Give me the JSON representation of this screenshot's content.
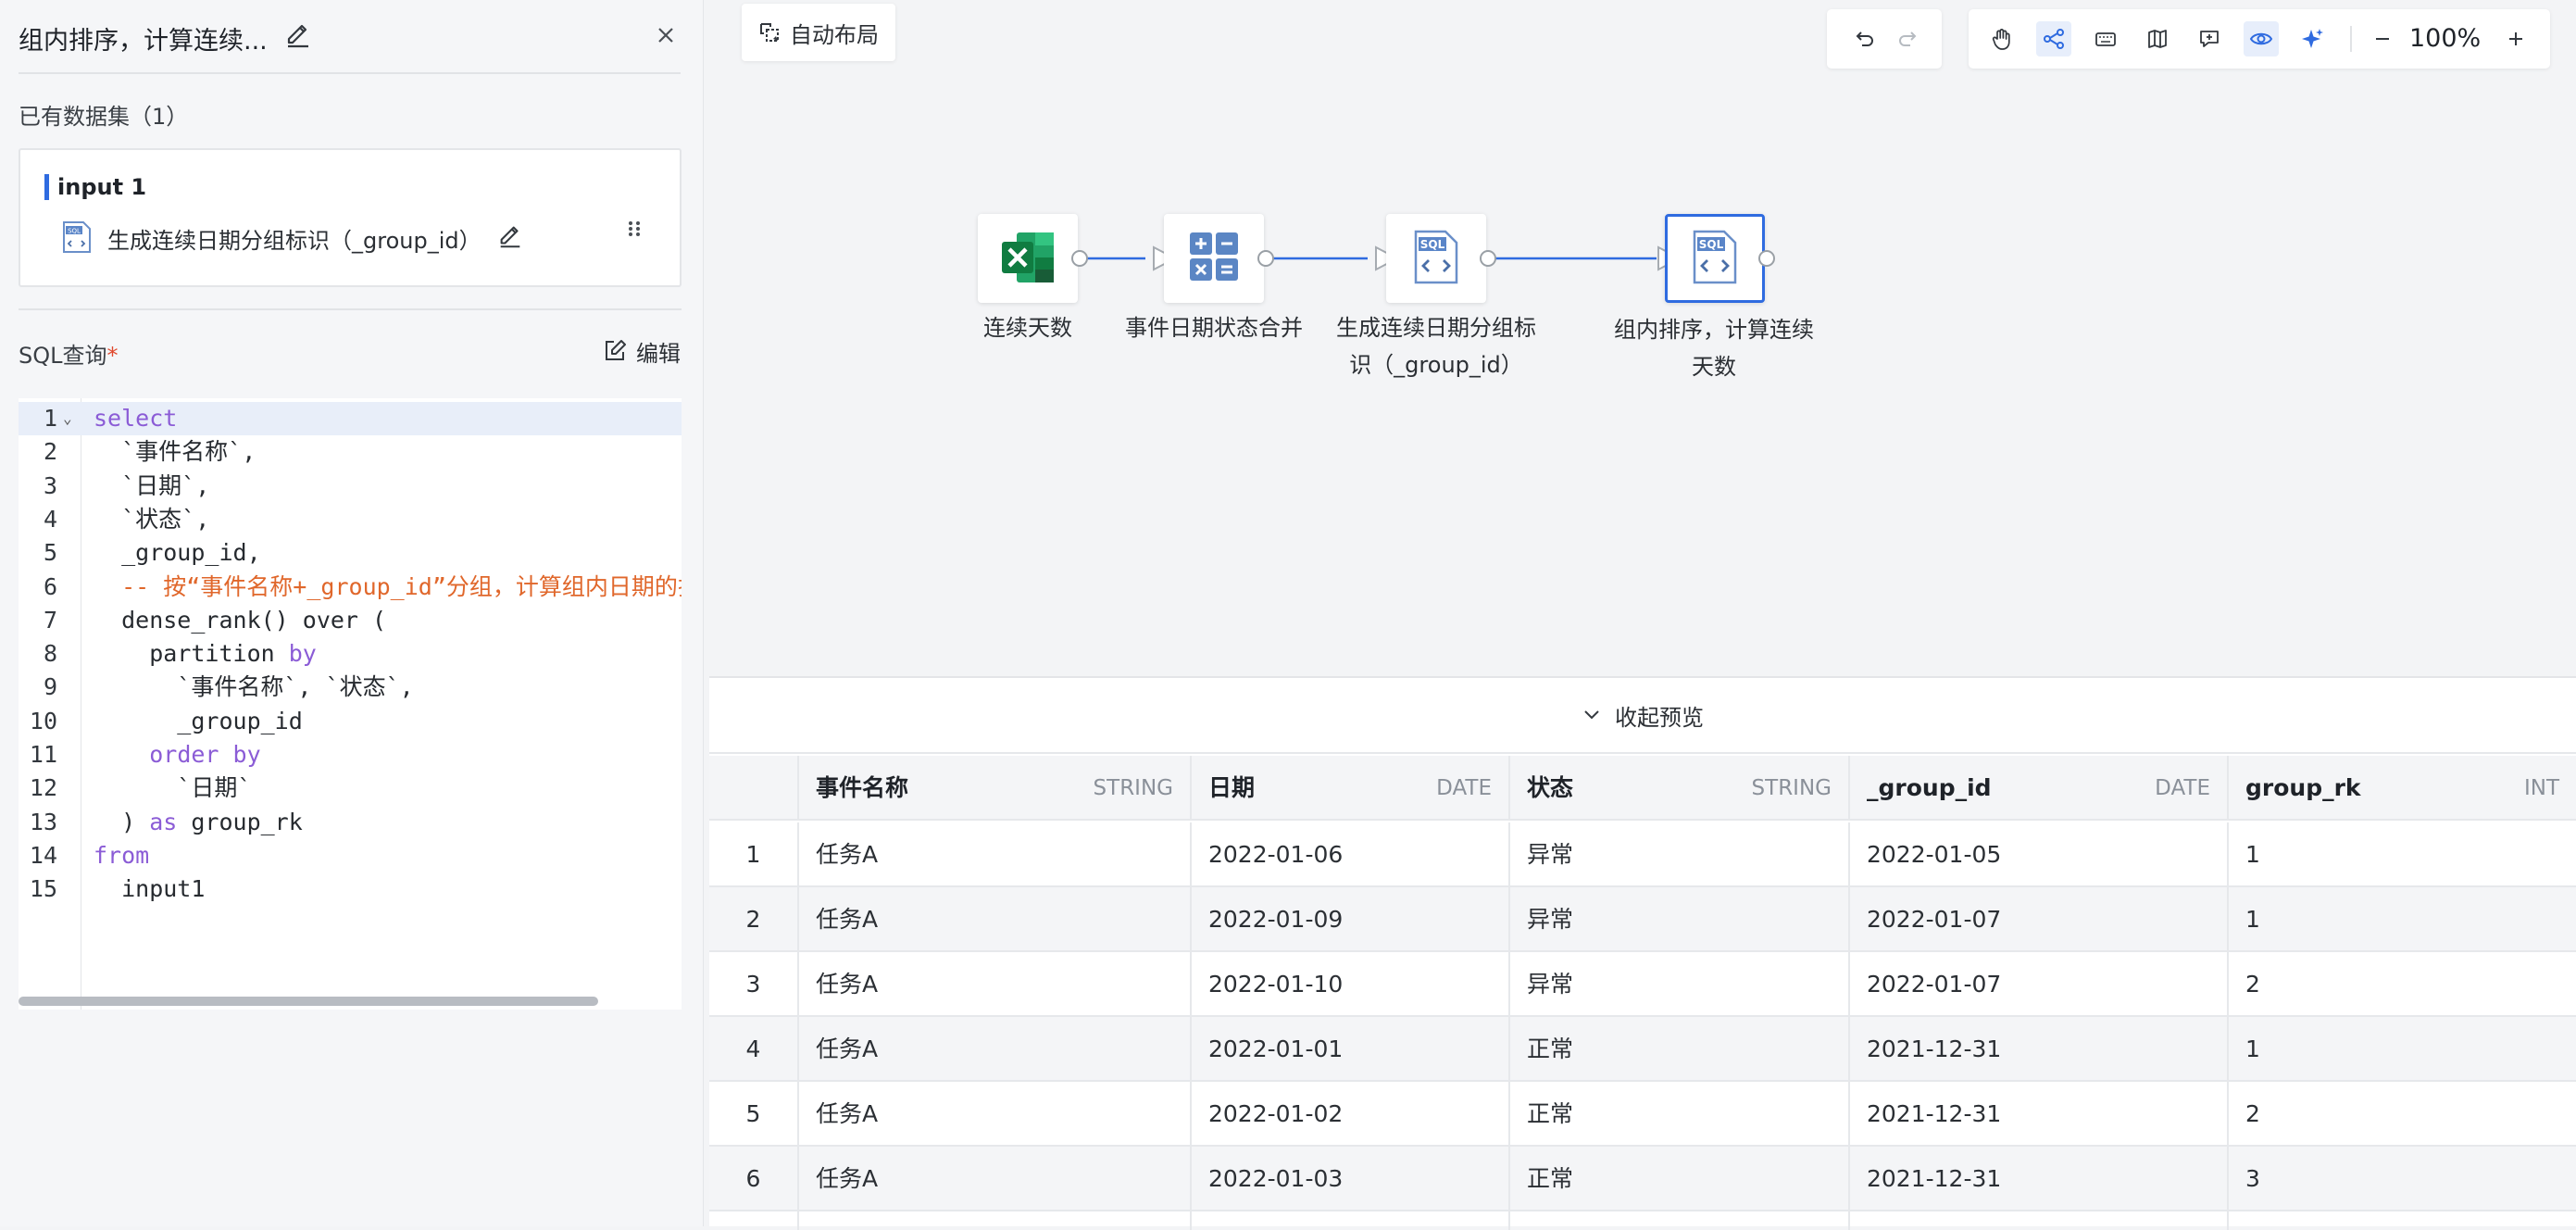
{
  "panel": {
    "title": "组内排序，计算连续...",
    "datasets_label": "已有数据集（1）",
    "dataset": {
      "name": "input 1",
      "source": "生成连续日期分组标识（_group_id）"
    },
    "sql_label": "SQL查询",
    "required_mark": "*",
    "edit_label": "编辑"
  },
  "code": {
    "lines": [
      [
        {
          "t": "select",
          "c": "kw"
        }
      ],
      [
        {
          "t": "  `事件名称`,",
          "c": ""
        }
      ],
      [
        {
          "t": "  `日期`,",
          "c": ""
        }
      ],
      [
        {
          "t": "  `状态`,",
          "c": ""
        }
      ],
      [
        {
          "t": "  _group_id,",
          "c": ""
        }
      ],
      [
        {
          "t": "  -- 按“事件名称+_group_id”分组，计算组内日期的排名",
          "c": "cmt"
        }
      ],
      [
        {
          "t": "  dense_rank() over (",
          "c": ""
        }
      ],
      [
        {
          "t": "    partition ",
          "c": ""
        },
        {
          "t": "by",
          "c": "kw"
        }
      ],
      [
        {
          "t": "      `事件名称`, `状态`,",
          "c": ""
        }
      ],
      [
        {
          "t": "      _group_id",
          "c": ""
        }
      ],
      [
        {
          "t": "    ",
          "c": ""
        },
        {
          "t": "order by",
          "c": "kw"
        }
      ],
      [
        {
          "t": "      `日期`",
          "c": ""
        }
      ],
      [
        {
          "t": "  ) ",
          "c": ""
        },
        {
          "t": "as",
          "c": "kw"
        },
        {
          "t": " group_rk",
          "c": ""
        }
      ],
      [
        {
          "t": "from",
          "c": "kw"
        }
      ],
      [
        {
          "t": "  input1",
          "c": ""
        }
      ]
    ]
  },
  "canvas": {
    "auto_layout_label": "自动布局",
    "zoom": "100%",
    "nodes": [
      {
        "label_lines": [
          "连续天数"
        ],
        "icon": "excel-icon"
      },
      {
        "label_lines": [
          "事件日期状态合并"
        ],
        "icon": "calculator-icon"
      },
      {
        "label_lines": [
          "生成连续日期分组标",
          "识（_group_id）"
        ],
        "icon": "sql-file-icon"
      },
      {
        "label_lines": [
          "组内排序，计算连续",
          "天数"
        ],
        "icon": "sql-file-icon"
      }
    ]
  },
  "preview": {
    "collapse_label": "收起预览",
    "columns": [
      {
        "name": "事件名称",
        "type": "STRING"
      },
      {
        "name": "日期",
        "type": "DATE"
      },
      {
        "name": "状态",
        "type": "STRING"
      },
      {
        "name": "_group_id",
        "type": "DATE"
      },
      {
        "name": "group_rk",
        "type": "INT"
      }
    ],
    "rows": [
      [
        "1",
        "任务A",
        "2022-01-06",
        "异常",
        "2022-01-05",
        "1"
      ],
      [
        "2",
        "任务A",
        "2022-01-09",
        "异常",
        "2022-01-07",
        "1"
      ],
      [
        "3",
        "任务A",
        "2022-01-10",
        "异常",
        "2022-01-07",
        "2"
      ],
      [
        "4",
        "任务A",
        "2022-01-01",
        "正常",
        "2021-12-31",
        "1"
      ],
      [
        "5",
        "任务A",
        "2022-01-02",
        "正常",
        "2021-12-31",
        "2"
      ],
      [
        "6",
        "任务A",
        "2022-01-03",
        "正常",
        "2021-12-31",
        "3"
      ]
    ]
  }
}
